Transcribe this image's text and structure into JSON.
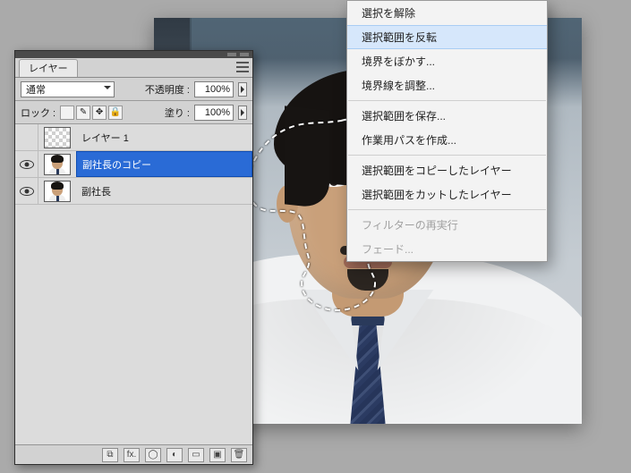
{
  "panel": {
    "tabs": {
      "layers": "レイヤー"
    },
    "blend_mode": "通常",
    "opacity_label": "不透明度 :",
    "opacity_value": "100%",
    "lock_label": "ロック :",
    "fill_label": "塗り :",
    "fill_value": "100%",
    "lock_icons": {
      "transparency": "▦",
      "paint": "✎",
      "position": "✥",
      "all": "🔒"
    }
  },
  "layers": [
    {
      "name": "レイヤー 1",
      "visible": false,
      "selected": false,
      "thumb": "checker"
    },
    {
      "name": "副社長のコピー",
      "visible": true,
      "selected": true,
      "thumb": "photo"
    },
    {
      "name": "副社長",
      "visible": true,
      "selected": false,
      "thumb": "photo"
    }
  ],
  "footer_icons": {
    "link": "⧉",
    "fx": "fx.",
    "mask": "◯",
    "adjust": "◐",
    "group": "▭",
    "new": "▣",
    "trash": "🗑"
  },
  "menu": {
    "deselect": "選択を解除",
    "inverse": "選択範囲を反転",
    "feather": "境界をぼかす...",
    "refine_edge": "境界線を調整...",
    "save_selection": "選択範囲を保存...",
    "make_work_path": "作業用パスを作成...",
    "layer_via_copy": "選択範囲をコピーしたレイヤー",
    "layer_via_cut": "選択範囲をカットしたレイヤー",
    "last_filter": "フィルターの再実行",
    "fade": "フェード..."
  }
}
